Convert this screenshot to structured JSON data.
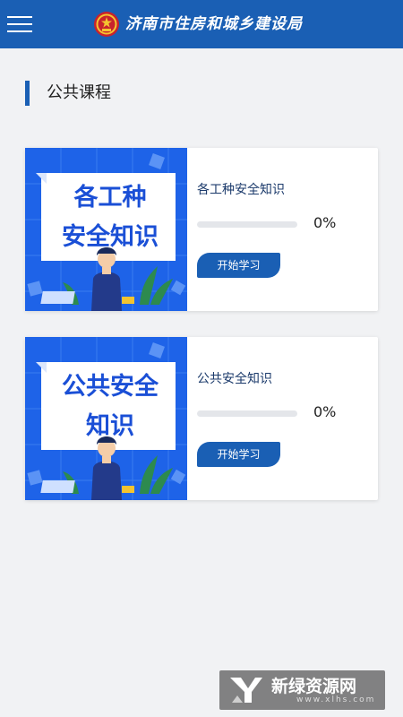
{
  "header": {
    "title": "济南市住房和城乡建设局",
    "menu_icon": "hamburger-menu-icon",
    "emblem_icon": "national-emblem-icon"
  },
  "section": {
    "title": "公共课程"
  },
  "courses": [
    {
      "thumb_lines": [
        "各工种",
        "安全知识"
      ],
      "title": "各工种安全知识",
      "progress": 0,
      "progress_label": "0%",
      "button_label": "开始学习"
    },
    {
      "thumb_lines": [
        "公共安全",
        "知识"
      ],
      "title": "公共安全知识",
      "progress": 0,
      "progress_label": "0%",
      "button_label": "开始学习"
    }
  ],
  "watermark": {
    "title": "新绿资源网",
    "url": "www.xlhs.com"
  },
  "colors": {
    "primary": "#1a5fb4",
    "background": "#f1f2f4"
  }
}
